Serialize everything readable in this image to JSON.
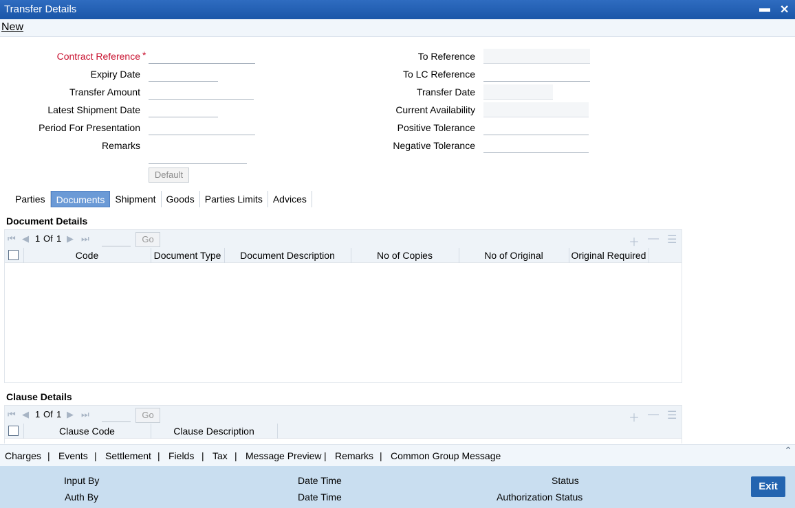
{
  "window": {
    "title": "Transfer Details",
    "minimize_icon": "minimize-icon",
    "close_icon": "close-icon"
  },
  "menu": {
    "new_label": "New"
  },
  "form": {
    "contract_reference": "Contract Reference",
    "required_mark": "*",
    "expiry_date": "Expiry Date",
    "transfer_amount": "Transfer Amount",
    "latest_shipment_date": "Latest Shipment Date",
    "period_for_presentation": "Period For Presentation",
    "remarks": "Remarks",
    "to_reference": "To Reference",
    "to_lc_reference": "To LC Reference",
    "transfer_date": "Transfer Date",
    "current_availability": "Current Availability",
    "positive_tolerance": "Positive Tolerance",
    "negative_tolerance": "Negative Tolerance",
    "default_button": "Default"
  },
  "tabs": [
    "Parties",
    "Documents",
    "Shipment",
    "Goods",
    "Parties Limits",
    "Advices"
  ],
  "active_tab": "Documents",
  "documents": {
    "title": "Document Details",
    "pager": {
      "page": "1",
      "of": "Of",
      "total": "1",
      "go": "Go"
    },
    "columns": [
      "Code",
      "Document Type",
      "Document Description",
      "No of Copies",
      "No of Original",
      "Original Required"
    ]
  },
  "clauses": {
    "title": "Clause Details",
    "pager": {
      "page": "1",
      "of": "Of",
      "total": "1",
      "go": "Go"
    },
    "columns": [
      "Clause Code",
      "Clause Description"
    ]
  },
  "footer_links": [
    "Charges",
    "Events",
    "Settlement",
    "Fields",
    "Tax",
    "Message Preview",
    "Remarks",
    "Common Group Message"
  ],
  "status": {
    "input_by": "Input By",
    "auth_by": "Auth By",
    "date_time_1": "Date Time",
    "date_time_2": "Date Time",
    "status": "Status",
    "authorization_status": "Authorization Status",
    "exit": "Exit"
  },
  "colors": {
    "title_bar": "#1a56a8",
    "active_tab": "#6b9ad6",
    "status_bar": "#c9def0",
    "exit_button": "#2364b0",
    "required": "#c8102e"
  }
}
